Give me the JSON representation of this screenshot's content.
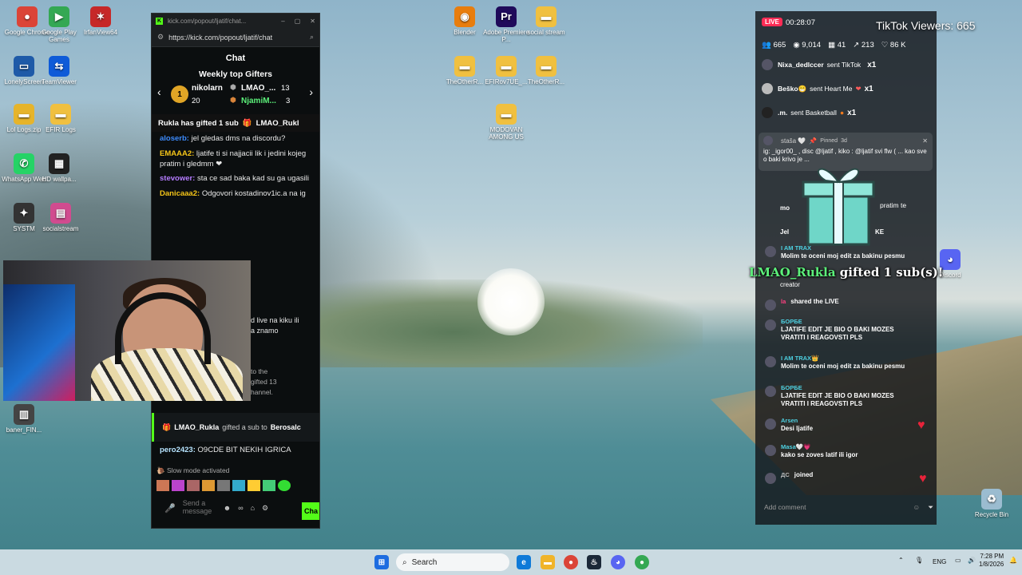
{
  "desktop": {
    "icons": [
      {
        "label": "Google Chrome",
        "color": "#db4437",
        "glyph": "●"
      },
      {
        "label": "Google Play Games",
        "color": "#34a853",
        "glyph": "▶"
      },
      {
        "label": "IrfanView64",
        "color": "#c62828",
        "glyph": "✶"
      },
      {
        "label": "LonelyScreen",
        "color": "#1e5aa8",
        "glyph": "▭"
      },
      {
        "label": "TeamViewer",
        "color": "#0e5bd8",
        "glyph": "⇆"
      },
      {
        "label": "Lol Logs.zip",
        "color": "#e6b42b",
        "glyph": "▬"
      },
      {
        "label": "EFIR Logs",
        "color": "#f0c040",
        "glyph": "▬"
      },
      {
        "label": "WhatsApp Web",
        "color": "#25d366",
        "glyph": "✆"
      },
      {
        "label": "HD wallpa...",
        "color": "#222222",
        "glyph": "▦"
      },
      {
        "label": "SYSTM",
        "color": "#333333",
        "glyph": "✦"
      },
      {
        "label": "socialstream",
        "color": "#d14b8f",
        "glyph": "▤"
      },
      {
        "label": "baner_FIN...",
        "color": "#444444",
        "glyph": "▥"
      },
      {
        "label": "Blender",
        "color": "#e87d0d",
        "glyph": "◉"
      },
      {
        "label": "Adobe Premiere P...",
        "color": "#1f0a5a",
        "glyph": "Pr"
      },
      {
        "label": "social stream",
        "color": "#f0c040",
        "glyph": "▬"
      },
      {
        "label": "TheOtherR...",
        "color": "#f0c040",
        "glyph": "▬"
      },
      {
        "label": "EFIRov7UE_...",
        "color": "#f0c040",
        "glyph": "▬"
      },
      {
        "label": "TheOtherR...",
        "color": "#f0c040",
        "glyph": "▬"
      },
      {
        "label": "MODOVAN AMONG US",
        "color": "#f0c040",
        "glyph": "▬"
      },
      {
        "label": "Discord",
        "color": "#5865f2",
        "glyph": "◕"
      },
      {
        "label": "Recycle Bin",
        "color": "#9bbcd0",
        "glyph": "♻"
      }
    ]
  },
  "kick": {
    "window_title": "kick.com/popout/ljatif/chat...",
    "url": "https://kick.com/popout/ljatif/chat",
    "chat_title": "Chat",
    "gifters_title": "Weekly top Gifters",
    "gifters": [
      {
        "rank": "1",
        "name": "nikolarn",
        "count": "20"
      },
      {
        "rank": "2",
        "name": "LMAO_...",
        "count": "13"
      },
      {
        "rank": "3",
        "name": "NjamiM...",
        "count": "3"
      }
    ],
    "pinned_gift": "Rukla has gifted 1 sub",
    "pinned_gift_user": "LMAO_Rukl",
    "messages": [
      {
        "user": "aloserb:",
        "text": "jel gledas dms na discordu?",
        "color": "#3d8bfd"
      },
      {
        "user": "EMAAA2:",
        "text": "ljatife ti si najjacii lik i jedini kojeg pratim i gledmm ❤",
        "color": "#f5c518"
      },
      {
        "user": "stevower:",
        "text": "sta ce sad baka kad su ga ugasili",
        "color": "#b57cff"
      },
      {
        "user": "Danicaaa2:",
        "text": "Odgovori kostadinov1ic.a na ig",
        "color": "#f5c518"
      }
    ],
    "partial_1": "d live na kiku ili",
    "partial_2": "a znamo",
    "partial_3": "to the",
    "partial_4": "gifted 13",
    "partial_5": "hannel.",
    "gift_line_user": "LMAO_Rukla",
    "gift_line_mid": "gifted a sub to",
    "gift_line_target": "Berosalc",
    "last_user": "pero2423:",
    "last_text": "O9CDE BIT NEKIH IGRICA",
    "slow_mode": "Slow mode activated",
    "input_placeholder": "Send a message",
    "chat_button": "Cha"
  },
  "tiktok": {
    "live_badge": "LIVE",
    "timer": "00:28:07",
    "viewers_overlay": "TikTok Viewers: 665",
    "stats": {
      "viewers": "665",
      "views": "9,014",
      "count3": "41",
      "count4": "213",
      "likes": "86 K"
    },
    "gift_lines": [
      {
        "user": "Nixa_dedlccer",
        "text": "sent TikTok",
        "mult": "x1"
      },
      {
        "user": "Beško😁",
        "text": "sent Heart Me",
        "mult": "x1"
      },
      {
        "user": ".m.",
        "text": "sent Basketball",
        "mult": "x1"
      }
    ],
    "pinned_user": "staša 🤍",
    "pinned_label": "Pinned",
    "pinned_time": "3d",
    "pinned_text": "ig: _igor00_ , disc @ljatif , kiko : @ljatif svi flw ( ... kao sve o baki krivo je ...",
    "gift_overlay_user": "LMAO_Rukla",
    "gift_overlay_text": "gifted 1 sub(s)!",
    "partial_pratim": "pratim te",
    "partial_mo": "mo",
    "partial_jel": "Jel",
    "partial_ke": "KE",
    "partial_creator": "creator",
    "messages": [
      {
        "user": "I AM TRAX",
        "text": "Molim te oceni moj edit za bakinu pesmu",
        "ucolor": "#4dd0e1"
      },
      {
        "user": "la",
        "text": "shared the LIVE",
        "ucolor": "#ff4081"
      },
      {
        "user": "БОРБЕ",
        "text": "LJATIFE EDIT JE BIO O BAKI MOZES VRATITI I REAGOVSTI PLS",
        "ucolor": "#4dd0e1"
      },
      {
        "user": "I AM TRAX👑",
        "text": "Molim te oceni moj edit za bakinu pesmu",
        "ucolor": "#4dd0e1"
      },
      {
        "user": "БОРБЕ",
        "text": "LJATIFE EDIT JE BIO O BAKI MOZES VRATITI I REAGOVSTI PLS",
        "ucolor": "#4dd0e1"
      },
      {
        "user": "Arsen",
        "text": "Desi ljatife",
        "ucolor": "#4dd0e1"
      },
      {
        "user": "Masa🤍💗",
        "text": "kako se zoves latif ili igor",
        "ucolor": "#4dd0e1"
      },
      {
        "user": "ДС",
        "text": "joined",
        "ucolor": "#bbbbbb"
      }
    ],
    "add_comment": "Add comment"
  },
  "taskbar": {
    "search": "Search",
    "lang": "ENG",
    "time": "7:28 PM",
    "date": "1/8/2026"
  }
}
